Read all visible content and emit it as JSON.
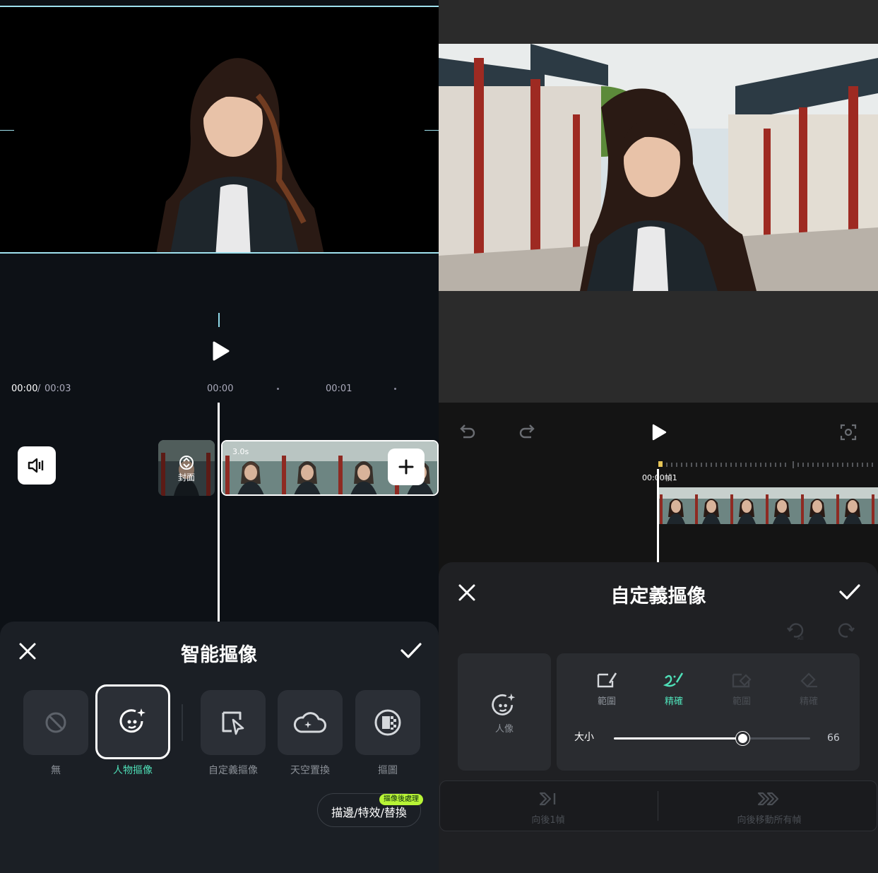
{
  "left": {
    "timecode_current": "00:00",
    "timecode_separator": " / ",
    "timecode_total": "00:03",
    "ruler_marks": [
      "00:00",
      "00:01"
    ],
    "cover_label": "封面",
    "clip_duration": "3.0s",
    "sheet_title": "智能摳像",
    "tools": [
      {
        "label": "無",
        "icon": "none-icon",
        "selected": false
      },
      {
        "label": "人物摳像",
        "icon": "portrait-cutout-icon",
        "selected": true
      },
      {
        "label": "自定義摳像",
        "icon": "custom-cutout-icon",
        "selected": false
      },
      {
        "label": "天空置換",
        "icon": "sky-replace-icon",
        "selected": false
      },
      {
        "label": "摳圖",
        "icon": "matte-icon",
        "selected": false
      }
    ],
    "stroke_button": "描邊/特效/替換",
    "stroke_badge": "摳像後處理"
  },
  "right": {
    "timecode": "00:00幀1",
    "sheet_title": "自定義摳像",
    "undo_all_icon": "undo-all-icon",
    "redo_all_icon": "redo-all-icon",
    "portrait_label": "人像",
    "brushes": [
      {
        "label": "範圍",
        "icon": "range-pen-icon",
        "state": "normal"
      },
      {
        "label": "精確",
        "icon": "precise-brush-icon",
        "state": "active"
      },
      {
        "label": "範圍",
        "icon": "range-eraser-icon",
        "state": "disabled"
      },
      {
        "label": "精確",
        "icon": "precise-eraser-icon",
        "state": "disabled"
      }
    ],
    "size_label": "大小",
    "size_value": "66",
    "size_level": 66,
    "frame_buttons": [
      {
        "label": "向後1幀",
        "icon": "next-frame-icon"
      },
      {
        "label": "向後移動所有幀",
        "icon": "move-all-frames-icon"
      }
    ]
  },
  "colors": {
    "accent": "#4fe0b8",
    "badge": "#b8f436",
    "preview_border": "#9fe1ee"
  }
}
